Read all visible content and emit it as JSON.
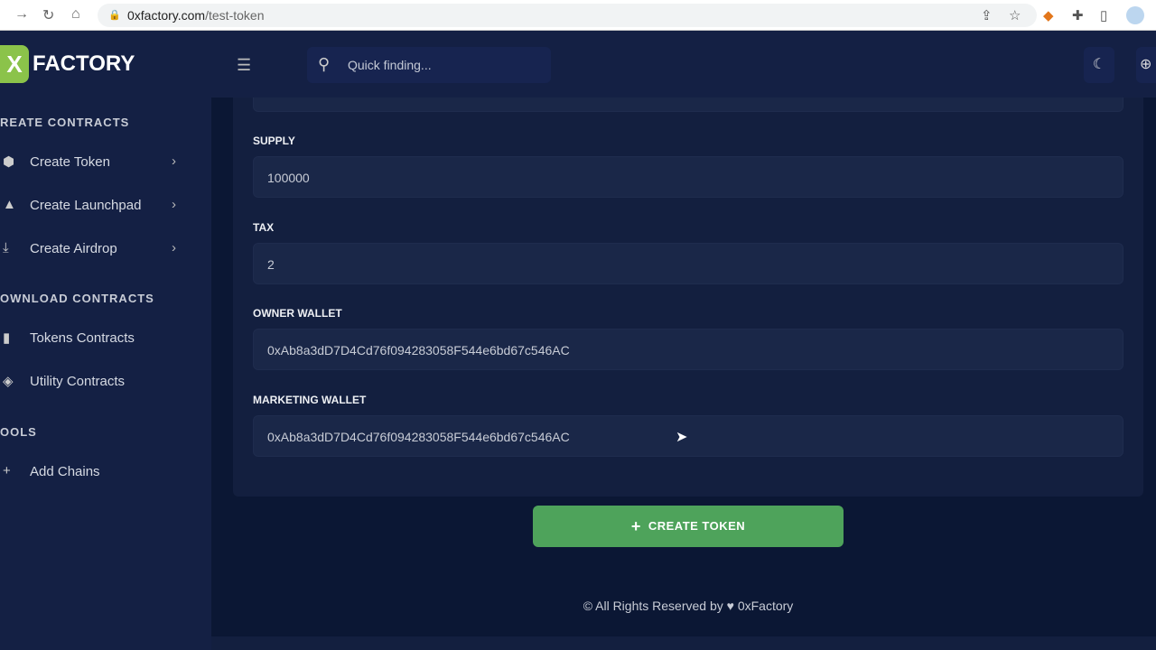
{
  "browser": {
    "domain": "0xfactory.com",
    "path": "/test-token"
  },
  "header": {
    "logo_mark": "X",
    "logo_text": "FACTORY",
    "search_placeholder": "Quick finding..."
  },
  "sidebar": {
    "sections": [
      {
        "title": "REATE CONTRACTS"
      },
      {
        "title": "OWNLOAD CONTRACTS"
      },
      {
        "title": "OOLS"
      }
    ],
    "items": [
      {
        "label": "Create Token",
        "icon": "cube-icon"
      },
      {
        "label": "Create Launchpad",
        "icon": "rocket-icon"
      },
      {
        "label": "Create Airdrop",
        "icon": "download-icon"
      },
      {
        "label": "Tokens Contracts",
        "icon": "book-icon"
      },
      {
        "label": "Utility Contracts",
        "icon": "layers-icon"
      },
      {
        "label": "Add Chains",
        "icon": "plus-icon"
      }
    ]
  },
  "form": {
    "supply": {
      "label": "SUPPLY",
      "value": "100000"
    },
    "tax": {
      "label": "TAX",
      "value": "2"
    },
    "owner_wallet": {
      "label": "OWNER WALLET",
      "value": "0xAb8a3dD7D4Cd76f094283058F544e6bd67c546AC"
    },
    "marketing_wallet": {
      "label": "MARKETING WALLET",
      "value": "0xAb8a3dD7D4Cd76f094283058F544e6bd67c546AC"
    },
    "submit_label": "CREATE TOKEN"
  },
  "footer": {
    "text_before": "© All Rights Reserved by",
    "text_after": "0xFactory"
  },
  "colors": {
    "accent": "#4ea35b",
    "sidebar": "#142044",
    "background": "#0b1734"
  }
}
